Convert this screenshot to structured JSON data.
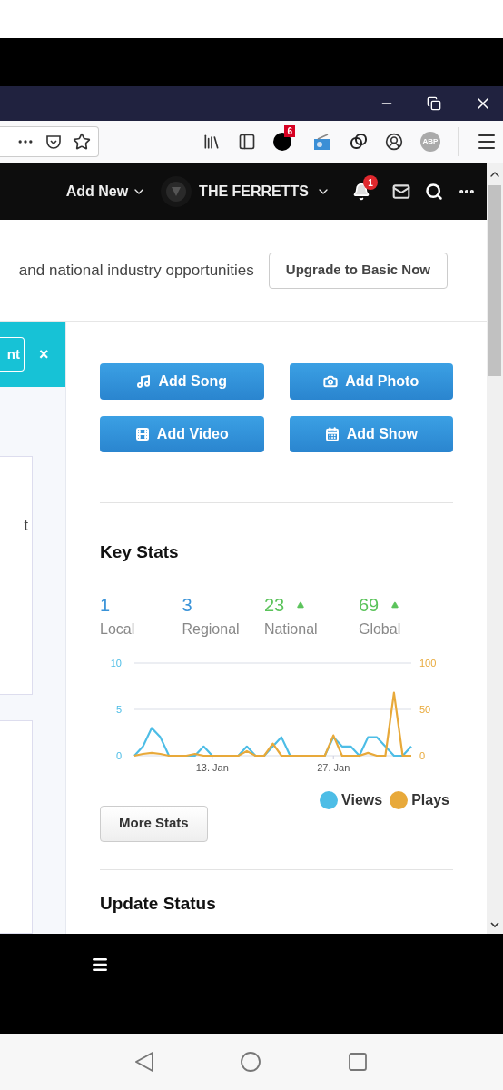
{
  "browser": {
    "extension_badge": "6",
    "adblock_label": "ABP"
  },
  "site_header": {
    "add_new": "Add New",
    "band_name": "THE FERRETTS",
    "notification_count": "1"
  },
  "banner": {
    "text": "and national industry opportunities",
    "button": "Upgrade to Basic Now"
  },
  "left_panel": {
    "notice_button": "nt",
    "close": "×",
    "card_text": "t"
  },
  "actions": [
    {
      "kind": "song",
      "label": "Add Song"
    },
    {
      "label": "Add Photo"
    },
    {
      "kind": "video",
      "label": "Add Video"
    },
    {
      "kind": "show",
      "label": "Add Show"
    }
  ],
  "key_stats": {
    "title": "Key Stats",
    "stats": [
      {
        "value": "1",
        "label": "Local",
        "kind": "flat"
      },
      {
        "value": "3",
        "label": "Regional",
        "kind": "flat"
      },
      {
        "value": "23",
        "label": "National",
        "kind": "up"
      },
      {
        "value": "69",
        "label": "Global",
        "kind": "up"
      }
    ],
    "views_chart": {
      "date_labels": [
        "13. Jan",
        "27. Jan"
      ],
      "chart_data": {
        "type": "line",
        "ylim": [
          0,
          10
        ],
        "yticks": [
          0,
          5,
          10
        ],
        "series": [
          {
            "name": "Views",
            "color": "#4dbde6",
            "values": [
              0,
              1,
              3,
              2,
              0,
              0,
              0,
              0,
              1,
              0,
              0,
              0,
              0,
              1,
              0,
              0,
              1,
              2,
              0,
              0,
              0,
              0,
              0,
              2,
              1,
              1,
              0,
              2,
              2,
              1,
              0,
              0,
              1
            ]
          }
        ]
      }
    },
    "plays_chart": {
      "chart_data": {
        "type": "line",
        "ylim": [
          0,
          100
        ],
        "yticks": [
          0,
          50,
          100
        ],
        "series": [
          {
            "name": "Plays",
            "color": "#e8a93a",
            "values": [
              0,
              2,
              3,
              2,
              0,
              0,
              0,
              2,
              0,
              0,
              0,
              0,
              0,
              5,
              0,
              0,
              13,
              0,
              0,
              0,
              0,
              0,
              0,
              22,
              0,
              0,
              0,
              3,
              0,
              0,
              68,
              0,
              0
            ]
          }
        ]
      }
    },
    "more_button": "More Stats"
  },
  "update_status": {
    "title": "Update Status"
  }
}
